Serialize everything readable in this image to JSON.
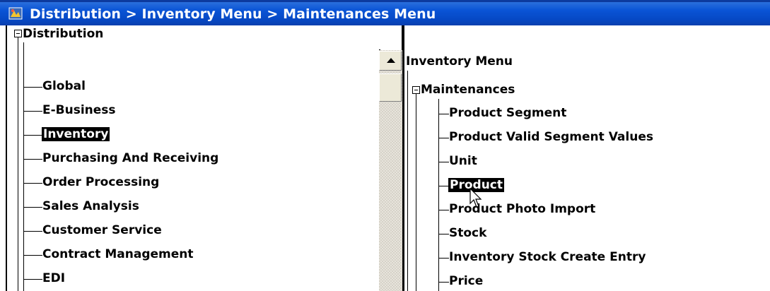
{
  "window": {
    "title": "Distribution > Inventory Menu > Maintenances Menu",
    "title_bar_color": "#0a54d6"
  },
  "left_tree": {
    "root": "Distribution",
    "items": [
      "Global",
      "E-Business",
      "Inventory",
      "Purchasing And Receiving",
      "Order Processing",
      "Sales Analysis",
      "Customer Service",
      "Contract Management",
      "EDI"
    ],
    "selected": "Inventory"
  },
  "right_tree": {
    "header": "Inventory Menu",
    "root": "Maintenances",
    "items": [
      "Product Segment",
      "Product Valid Segment Values",
      "Unit",
      "Product",
      "Product Photo Import",
      "Stock",
      "Inventory Stock Create Entry",
      "Price"
    ],
    "selected": "Product"
  }
}
